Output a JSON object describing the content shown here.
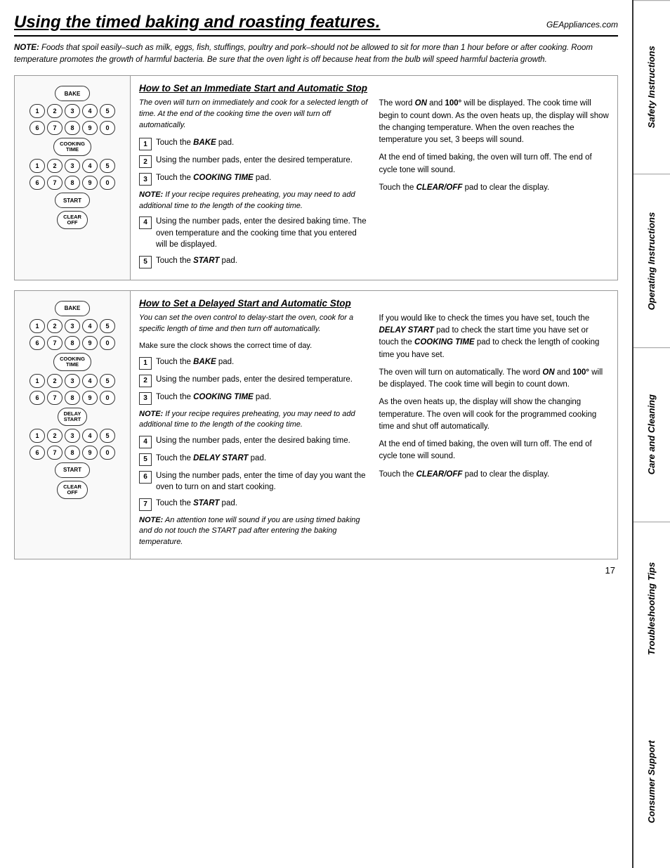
{
  "header": {
    "title": "Using the timed baking and roasting features.",
    "website": "GEAppliances.com"
  },
  "note_top": {
    "label": "NOTE:",
    "text": " Foods that spoil easily–such as milk, eggs, fish, stuffings, poultry and pork–should not be allowed to sit for more than 1 hour before or after cooking. Room temperature promotes the growth of harmful bacteria. Be sure that the oven light is off because heat from the bulb will speed harmful bacteria growth."
  },
  "section1": {
    "heading": "How to Set an Immediate Start and Automatic Stop",
    "intro": "The oven will turn on immediately and cook for a selected length of time. At the end of the cooking time the oven will turn off automatically.",
    "steps": [
      {
        "num": "1",
        "text_html": "Touch the <b><i>BAKE</i></b> pad."
      },
      {
        "num": "2",
        "text_html": "Using the number pads, enter the desired temperature."
      },
      {
        "num": "3",
        "text_html": "Touch the <b><i>COOKING TIME</i></b> pad."
      },
      {
        "num": "4",
        "text_html": "Using the number pads, enter the desired baking time. The oven temperature and the cooking time that you entered will be displayed."
      },
      {
        "num": "5",
        "text_html": "Touch the <b><i>START</i></b> pad."
      }
    ],
    "note": "<b><i>NOTE:</i></b><i> If your recipe requires preheating, you may need to add additional time to the length of the cooking time.</i>",
    "right_text": [
      "The word <b><i>ON</i></b> and <b>100°</b> will be displayed. The cook time will begin to count down. As the oven heats up, the display will show the changing temperature. When the oven reaches the temperature you set, 3 beeps will sound.",
      "At the end of timed baking, the oven will turn off. The end of cycle tone will sound.",
      "Touch the <b><i>CLEAR/OFF</i></b> pad to clear the display."
    ]
  },
  "section2": {
    "heading": "How to Set a Delayed Start and Automatic Stop",
    "intro": "You can set the oven control to delay-start the oven, cook for a specific length of time and then turn off automatically.",
    "intro2": "Make sure the clock shows the correct time of day.",
    "steps": [
      {
        "num": "1",
        "text_html": "Touch the <b><i>BAKE</i></b> pad."
      },
      {
        "num": "2",
        "text_html": "Using the number pads, enter the desired temperature."
      },
      {
        "num": "3",
        "text_html": "Touch the <b><i>COOKING TIME</i></b> pad."
      },
      {
        "num": "4",
        "text_html": "Using the number pads, enter the desired baking time."
      },
      {
        "num": "5",
        "text_html": "Touch the <b><i>DELAY START</i></b> pad."
      },
      {
        "num": "6",
        "text_html": "Using the number pads, enter the time of day you want the oven to turn on and start cooking."
      },
      {
        "num": "7",
        "text_html": "Touch the <b><i>START</i></b> pad."
      }
    ],
    "note_mid": "<b><i>NOTE:</i></b><i> If your recipe requires preheating, you may need to add additional time to the length of the cooking time.</i>",
    "note_end": "<b><i>NOTE:</i></b><i> An attention tone will sound if you are using timed baking and do not touch the START pad after entering the baking temperature.</i>",
    "right_text": [
      "If you would like to check the times you have set, touch the <b><i>DELAY START</i></b> pad to check the start time you have set or touch the <b><i>COOKING TIME</i></b> pad to check the length of cooking time you have set.",
      "The oven will turn on automatically. The word <b><i>ON</i></b> and <b>100°</b> will be displayed. The cook time will begin to count down.",
      "As the oven heats up, the display will show the changing temperature. The oven will cook for the programmed cooking time and shut off automatically.",
      "At the end of timed baking, the oven will turn off. The end of cycle tone will sound.",
      "Touch the <b><i>CLEAR/OFF</i></b> pad to clear the display."
    ]
  },
  "keypad1": {
    "rows_top": [
      [
        "1",
        "2",
        "3",
        "4",
        "5"
      ],
      [
        "6",
        "7",
        "8",
        "9",
        "0"
      ]
    ],
    "cooking_time": "COOKING\nTIME",
    "rows_mid": [
      [
        "1",
        "2",
        "3",
        "4",
        "5"
      ],
      [
        "6",
        "7",
        "8",
        "9",
        "0"
      ]
    ],
    "start": "START",
    "clear_off": "CLEAR\nOFF",
    "bake": "BAKE"
  },
  "keypad2": {
    "bake": "BAKE",
    "rows_top": [
      [
        "1",
        "2",
        "3",
        "4",
        "5"
      ],
      [
        "6",
        "7",
        "8",
        "9",
        "0"
      ]
    ],
    "cooking_time": "COOKING\nTIME",
    "rows_mid": [
      [
        "1",
        "2",
        "3",
        "4",
        "5"
      ],
      [
        "6",
        "7",
        "8",
        "9",
        "0"
      ]
    ],
    "delay_start": "DELAY\nSTART",
    "rows_bot": [
      [
        "1",
        "2",
        "3",
        "4",
        "5"
      ],
      [
        "6",
        "7",
        "8",
        "9",
        "0"
      ]
    ],
    "start": "START",
    "clear_off": "CLEAR\nOFF"
  },
  "sidebar": {
    "items": [
      "Safety Instructions",
      "Operating Instructions",
      "Care and Cleaning",
      "Troubleshooting Tips",
      "Consumer Support"
    ]
  },
  "page_number": "17"
}
